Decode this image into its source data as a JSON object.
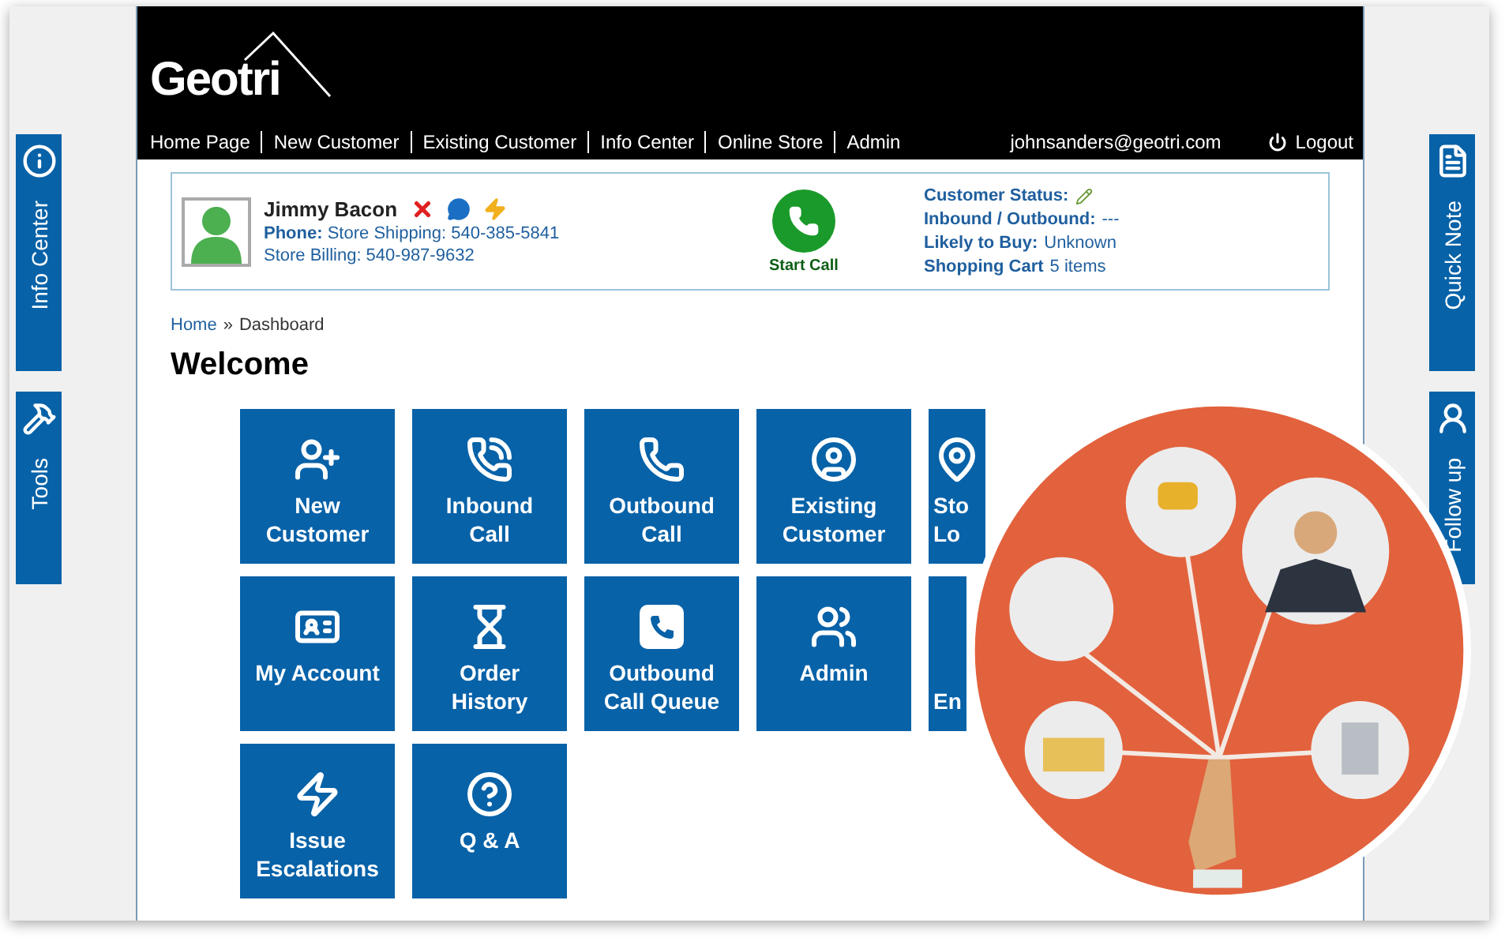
{
  "header": {
    "logo": "Geotri",
    "nav": [
      "Home Page",
      "New Customer",
      "Existing Customer",
      "Info Center",
      "Online Store",
      "Admin"
    ],
    "user_email": "johnsanders@geotri.com",
    "logout": "Logout"
  },
  "customer": {
    "name": "Jimmy Bacon",
    "phone_label": "Phone:",
    "phone_shipping": "Store Shipping: 540-385-5841",
    "phone_billing": "Store Billing: 540-987-9632",
    "call_button": "Start Call",
    "status": [
      {
        "label": "Customer Status:",
        "kind": "edit"
      },
      {
        "label": "Inbound / Outbound:",
        "value": "---",
        "kind": "text"
      },
      {
        "label": "Likely to Buy:",
        "value": "Unknown",
        "kind": "text"
      },
      {
        "label": "Shopping Cart",
        "value": "5  items",
        "kind": "text"
      }
    ]
  },
  "breadcrumb": {
    "items": [
      "Home"
    ],
    "separator": "»",
    "current": "Dashboard"
  },
  "title": "Welcome",
  "tiles": [
    {
      "lines": [
        "New",
        "Customer"
      ],
      "kind": "full"
    },
    {
      "lines": [
        "Inbound",
        "Call"
      ],
      "kind": "full"
    },
    {
      "lines": [
        "Outbound",
        "Call"
      ],
      "kind": "full"
    },
    {
      "lines": [
        "Existing",
        "Customer"
      ],
      "kind": "full"
    },
    {
      "lines": [
        "Sto",
        "Lo"
      ],
      "kind": "cut"
    },
    {
      "lines": [
        "My Account"
      ],
      "kind": "full"
    },
    {
      "lines": [
        "Order",
        "History"
      ],
      "kind": "full"
    },
    {
      "lines": [
        "Outbound",
        "Call Queue"
      ],
      "kind": "full"
    },
    {
      "lines": [
        "Admin"
      ],
      "kind": "full"
    },
    {
      "lines": [
        "En"
      ],
      "kind": "cut"
    },
    {
      "lines": [
        "Issue",
        "Escalations"
      ],
      "kind": "full"
    },
    {
      "lines": [
        "Q & A"
      ],
      "kind": "full"
    }
  ],
  "side_tabs_left": [
    {
      "label": "Info Center"
    },
    {
      "label": "Tools"
    }
  ],
  "side_tabs_right": [
    {
      "label": "Quick Note"
    },
    {
      "label": "Follow up"
    }
  ]
}
